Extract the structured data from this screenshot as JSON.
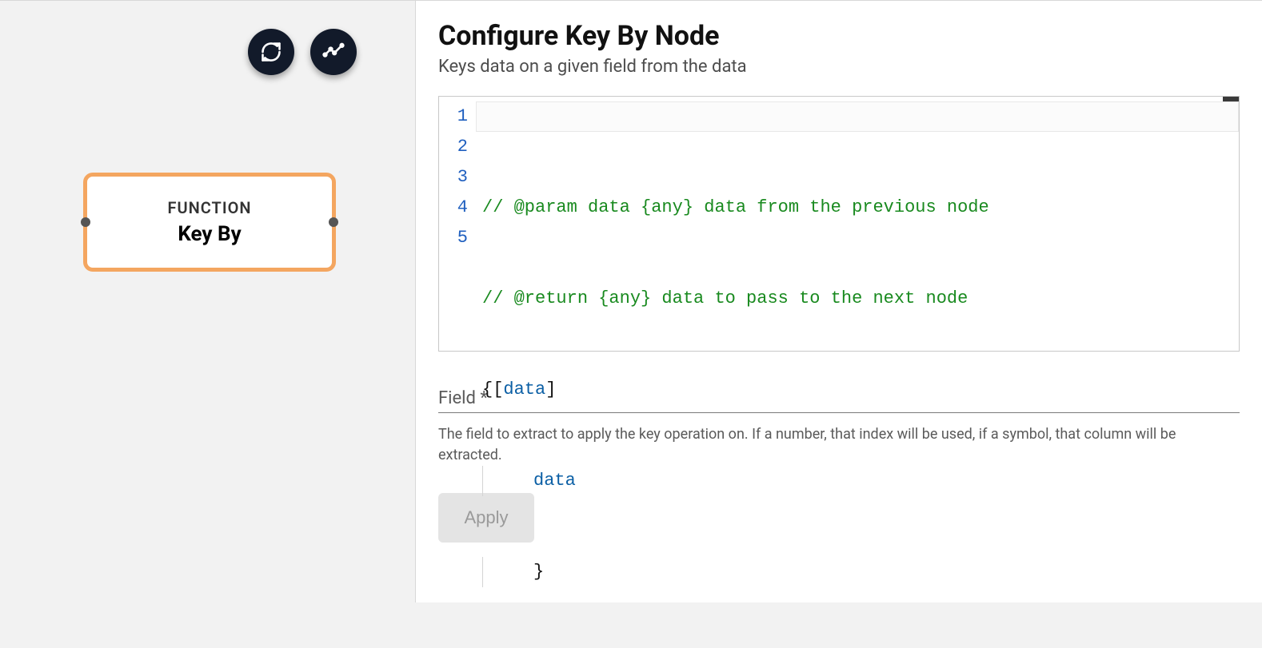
{
  "toolbar": {
    "sync_icon": "sync-icon",
    "analytics_icon": "analytics-icon"
  },
  "node": {
    "type_label": "FUNCTION",
    "title": "Key By"
  },
  "config": {
    "title": "Configure Key By Node",
    "subtitle": "Keys data on a given field from the data",
    "apply_label": "Apply"
  },
  "editor": {
    "line_numbers": [
      "1",
      "2",
      "3",
      "4",
      "5"
    ],
    "line1_comment": "// @param data {any} data from the previous node",
    "line2_comment": "// @return {any} data to pass to the next node",
    "line3_open_brace": "{",
    "line3_open_bracket": "[",
    "line3_ident": "data",
    "line3_close_bracket": "]",
    "line4_ident": "data",
    "line5_close_brace": "}"
  },
  "field": {
    "label": "Field *",
    "value": "",
    "help": "The field to extract to apply the key operation on. If a number, that index will be used, if a symbol, that column will be extracted."
  }
}
